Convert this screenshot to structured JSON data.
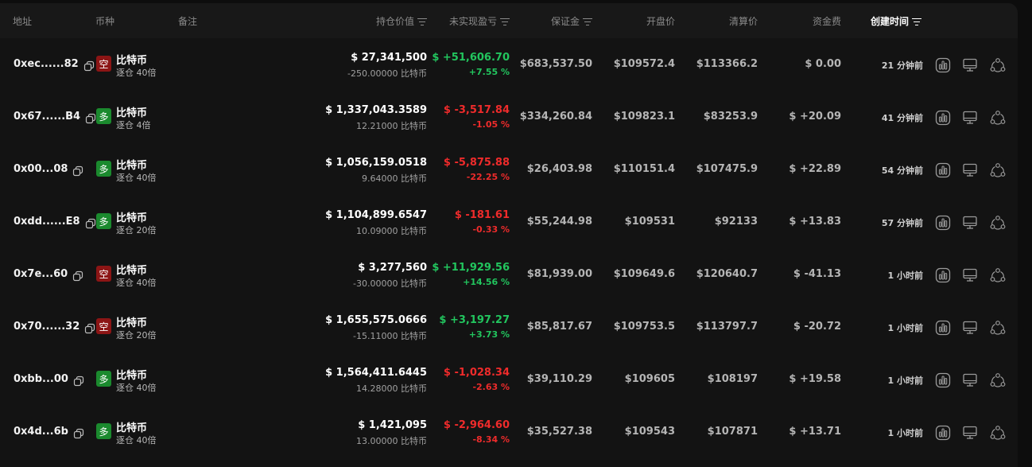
{
  "header": {
    "address": "地址",
    "coin": "币种",
    "note": "备注",
    "position_value": "持仓价值",
    "unrealized_pnl": "未实现盈亏",
    "margin": "保证金",
    "open_price": "开盘价",
    "liq_price": "清算价",
    "funding": "资金费",
    "created": "创建时间"
  },
  "colors": {
    "positive": "#22c55e",
    "negative": "#ef2b2b",
    "short_badge": "#8c1515",
    "long_badge": "#1b8a2e"
  },
  "icons": [
    "copy-icon",
    "sort-icon",
    "chart-icon",
    "monitor-icon",
    "share-icon"
  ],
  "rows": [
    {
      "address": "0xec......82",
      "side": "空",
      "side_type": "short",
      "coin": "比特币",
      "leverage": "逐仓 40倍",
      "value": "$ 27,341,500",
      "size": "-250.00000 比特币",
      "pnl": "$ +51,606.70",
      "pnl_pct": "+7.55 %",
      "pnl_sign": "pos",
      "margin": "$683,537.50",
      "open": "$109572.4",
      "liq": "$113366.2",
      "funding": "$ 0.00",
      "funding_sign": "neutral",
      "time": "21 分钟前"
    },
    {
      "address": "0x67......B4",
      "side": "多",
      "side_type": "long",
      "coin": "比特币",
      "leverage": "逐仓 4倍",
      "value": "$ 1,337,043.3589",
      "size": "12.21000 比特币",
      "pnl": "$ -3,517.84",
      "pnl_pct": "-1.05 %",
      "pnl_sign": "neg",
      "margin": "$334,260.84",
      "open": "$109823.1",
      "liq": "$83253.9",
      "funding": "$ +20.09",
      "funding_sign": "pos",
      "time": "41 分钟前"
    },
    {
      "address": "0x00...08",
      "side": "多",
      "side_type": "long",
      "coin": "比特币",
      "leverage": "逐仓 40倍",
      "value": "$ 1,056,159.0518",
      "size": "9.64000 比特币",
      "pnl": "$ -5,875.88",
      "pnl_pct": "-22.25 %",
      "pnl_sign": "neg",
      "margin": "$26,403.98",
      "open": "$110151.4",
      "liq": "$107475.9",
      "funding": "$ +22.89",
      "funding_sign": "pos",
      "time": "54 分钟前"
    },
    {
      "address": "0xdd......E8",
      "side": "多",
      "side_type": "long",
      "coin": "比特币",
      "leverage": "逐仓 20倍",
      "value": "$ 1,104,899.6547",
      "size": "10.09000 比特币",
      "pnl": "$ -181.61",
      "pnl_pct": "-0.33 %",
      "pnl_sign": "neg",
      "margin": "$55,244.98",
      "open": "$109531",
      "liq": "$92133",
      "funding": "$ +13.83",
      "funding_sign": "pos",
      "time": "57 分钟前"
    },
    {
      "address": "0x7e...60",
      "side": "空",
      "side_type": "short",
      "coin": "比特币",
      "leverage": "逐仓 40倍",
      "value": "$ 3,277,560",
      "size": "-30.00000 比特币",
      "pnl": "$ +11,929.56",
      "pnl_pct": "+14.56 %",
      "pnl_sign": "pos",
      "margin": "$81,939.00",
      "open": "$109649.6",
      "liq": "$120640.7",
      "funding": "$ -41.13",
      "funding_sign": "neg",
      "time": "1 小时前"
    },
    {
      "address": "0x70......32",
      "side": "空",
      "side_type": "short",
      "coin": "比特币",
      "leverage": "逐仓 20倍",
      "value": "$ 1,655,575.0666",
      "size": "-15.11000 比特币",
      "pnl": "$ +3,197.27",
      "pnl_pct": "+3.73 %",
      "pnl_sign": "pos",
      "margin": "$85,817.67",
      "open": "$109753.5",
      "liq": "$113797.7",
      "funding": "$ -20.72",
      "funding_sign": "neg",
      "time": "1 小时前"
    },
    {
      "address": "0xbb...00",
      "side": "多",
      "side_type": "long",
      "coin": "比特币",
      "leverage": "逐仓 40倍",
      "value": "$ 1,564,411.6445",
      "size": "14.28000 比特币",
      "pnl": "$ -1,028.34",
      "pnl_pct": "-2.63 %",
      "pnl_sign": "neg",
      "margin": "$39,110.29",
      "open": "$109605",
      "liq": "$108197",
      "funding": "$ +19.58",
      "funding_sign": "pos",
      "time": "1 小时前"
    },
    {
      "address": "0x4d...6b",
      "side": "多",
      "side_type": "long",
      "coin": "比特币",
      "leverage": "逐仓 40倍",
      "value": "$ 1,421,095",
      "size": "13.00000 比特币",
      "pnl": "$ -2,964.60",
      "pnl_pct": "-8.34 %",
      "pnl_sign": "neg",
      "margin": "$35,527.38",
      "open": "$109543",
      "liq": "$107871",
      "funding": "$ +13.71",
      "funding_sign": "pos",
      "time": "1 小时前"
    }
  ]
}
